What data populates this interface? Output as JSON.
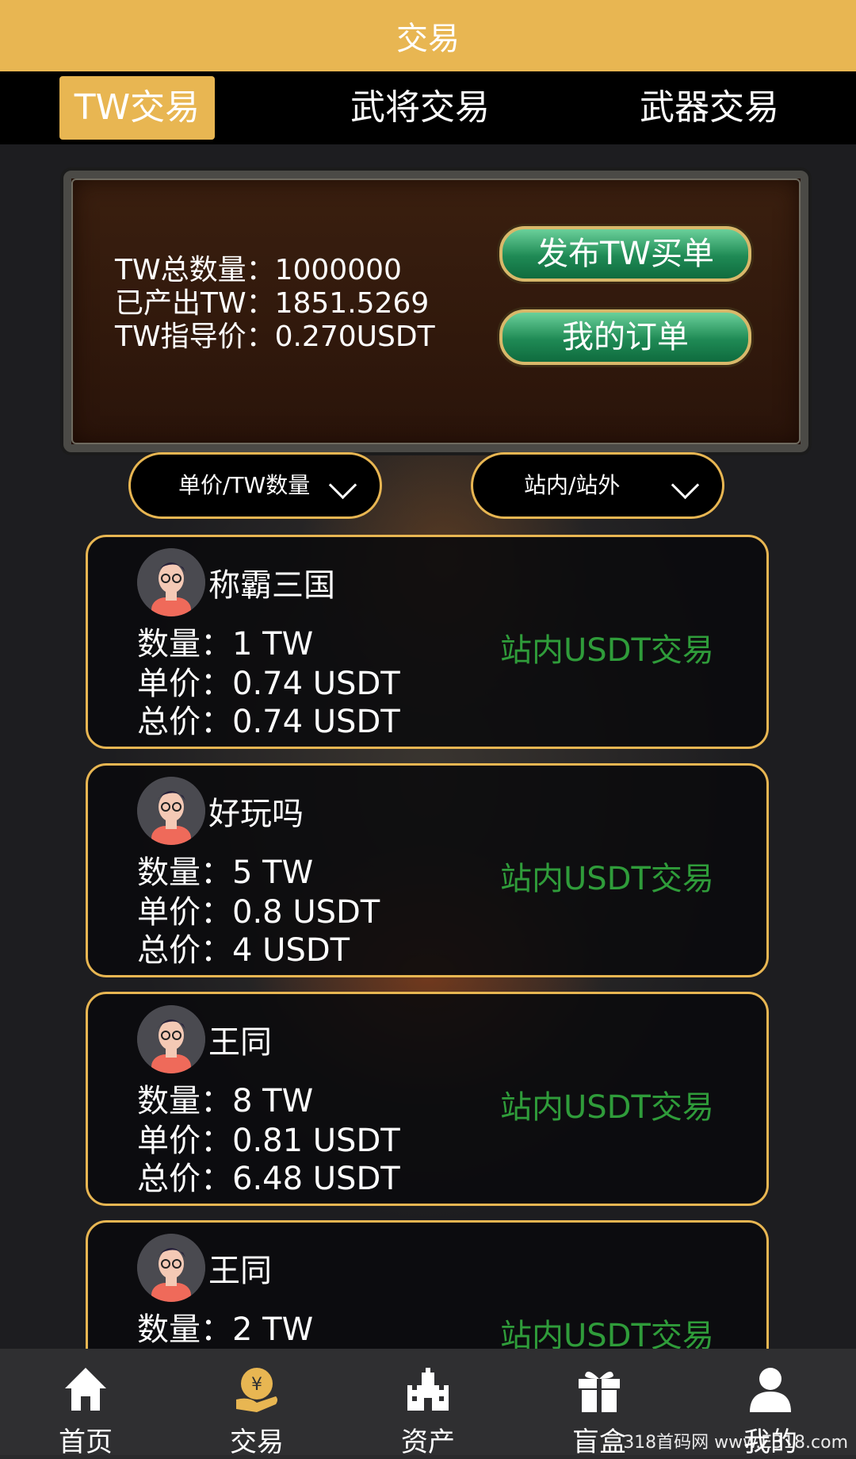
{
  "header": {
    "title": "交易"
  },
  "tabs": [
    {
      "label": "TW交易",
      "active": true
    },
    {
      "label": "武将交易",
      "active": false
    },
    {
      "label": "武器交易",
      "active": false
    }
  ],
  "info": {
    "total": "TW总数量：1000000",
    "produced": "已产出TW：1851.5269",
    "guide_price": "TW指导价：0.270USDT",
    "publish_button": "发布TW买单",
    "orders_button": "我的订单"
  },
  "filters": {
    "sort": "单价/TW数量",
    "scope": "站内/站外"
  },
  "listings": [
    {
      "name": "称霸三国",
      "qty": "数量：1 TW",
      "price": "单价：0.74 USDT",
      "total": "总价：0.74 USDT",
      "tag": "站内USDT交易"
    },
    {
      "name": "好玩吗",
      "qty": "数量：5 TW",
      "price": "单价：0.8 USDT",
      "total": "总价：4 USDT",
      "tag": "站内USDT交易"
    },
    {
      "name": "王同",
      "qty": "数量：8 TW",
      "price": "单价：0.81 USDT",
      "total": "总价：6.48 USDT",
      "tag": "站内USDT交易"
    },
    {
      "name": "王同",
      "qty": "数量：2 TW",
      "price": "",
      "total": "",
      "tag": "站内USDT交易"
    }
  ],
  "nav": [
    {
      "label": "首页",
      "icon": "home-icon"
    },
    {
      "label": "交易",
      "icon": "trade-coin-icon"
    },
    {
      "label": "资产",
      "icon": "castle-icon"
    },
    {
      "label": "盲盒",
      "icon": "gift-box-icon"
    },
    {
      "label": "我的",
      "icon": "user-icon"
    }
  ],
  "watermark": "318首码网 www.E318.com",
  "colors": {
    "accent": "#e8b652",
    "green_tag": "#2f9c3a",
    "button_green": "#1f8a55"
  }
}
